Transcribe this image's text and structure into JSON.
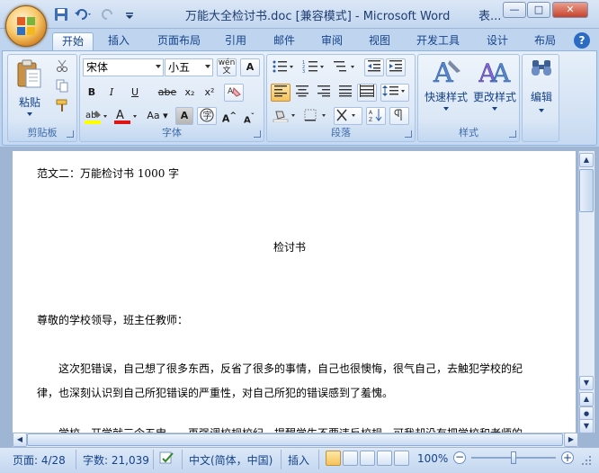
{
  "window": {
    "title": "万能大全检讨书.doc [兼容模式] - Microsoft Word",
    "title_ext": "表...",
    "minimize": "—",
    "maximize": "□",
    "close": "✕"
  },
  "tabs": [
    {
      "label": "开始",
      "active": true
    },
    {
      "label": "插入"
    },
    {
      "label": "页面布局"
    },
    {
      "label": "引用"
    },
    {
      "label": "邮件"
    },
    {
      "label": "审阅"
    },
    {
      "label": "视图"
    },
    {
      "label": "开发工具"
    },
    {
      "label": "设计"
    },
    {
      "label": "布局"
    }
  ],
  "ribbon": {
    "clipboard": {
      "paste_label": "粘贴",
      "group_label": "剪贴板"
    },
    "font": {
      "font_name": "宋体",
      "font_size": "小五",
      "wen_label": "wén",
      "bold": "B",
      "italic": "I",
      "underline": "U",
      "strike": "abe",
      "subscript": "x₂",
      "superscript": "x²",
      "aa_label": "Aa",
      "group_label": "字体"
    },
    "paragraph": {
      "group_label": "段落"
    },
    "styles": {
      "quick_styles": "快速样式",
      "change_styles": "更改样式",
      "group_label": "样式"
    },
    "editing": {
      "label": "编辑"
    }
  },
  "document": {
    "lines": [
      "范文二：万能检讨书 1000 字",
      "检讨书",
      "尊敬的学校领导，班主任教师：",
      "这次犯错误，自己想了很多东西，反省了很多的事情，自己也很懊悔，很气自己，去触犯学校的纪",
      "律，也深刻认识到自己所犯错误的严重性，对自己所犯的错误感到了羞愧。",
      "学校一开学就三令五申，一再强调校规校纪，提醒学生不要违反校规，可我却没有把学校和老师的"
    ]
  },
  "statusbar": {
    "page": "页面: 4/28",
    "words": "字数: 21,039",
    "language": "中文(简体，中国)",
    "mode": "插入",
    "zoom": "100%",
    "zoom_level": 0.5
  }
}
